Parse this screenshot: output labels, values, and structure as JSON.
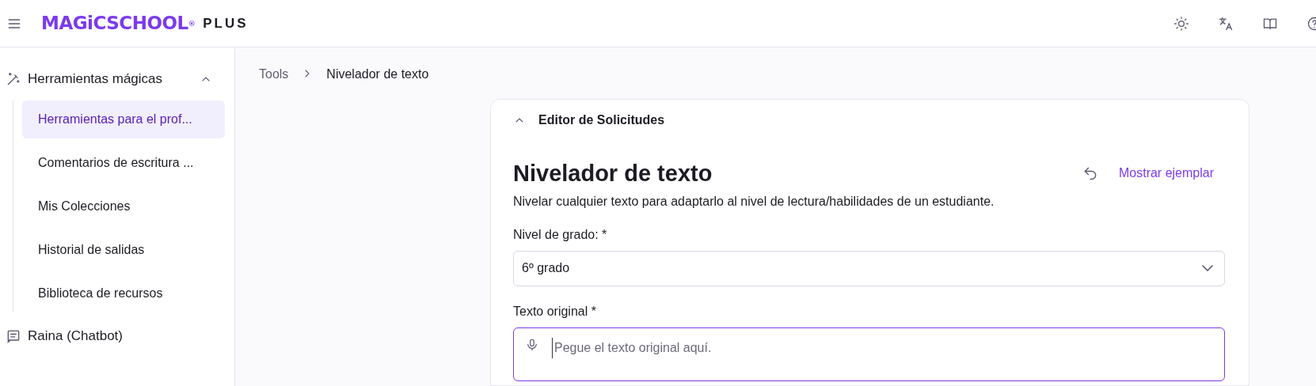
{
  "header": {
    "logo": "MAGiCSCHOOL",
    "logo_mark": "®",
    "plan": "PLUS"
  },
  "sidebar": {
    "groups": [
      {
        "label": "Herramientas mágicas",
        "expanded": true,
        "items": [
          {
            "label": "Herramientas para el prof...",
            "selected": true
          },
          {
            "label": "Comentarios de escritura ...",
            "selected": false
          },
          {
            "label": "Mis Colecciones",
            "selected": false
          },
          {
            "label": "Historial de salidas",
            "selected": false
          },
          {
            "label": "Biblioteca de recursos",
            "selected": false
          }
        ]
      },
      {
        "label": "Raina (Chatbot)"
      }
    ]
  },
  "breadcrumb": [
    "Tools",
    "Nivelador de texto"
  ],
  "panel": {
    "title": "Editor de Solicitudes",
    "expanded": true,
    "heading": "Nivelador de texto",
    "example_link": "Mostrar ejemplar",
    "description": "Nivelar cualquier texto para adaptarlo al nivel de lectura/habilidades de un estudiante.",
    "fields": [
      {
        "kind": "select",
        "label": "Nivel de grado: *",
        "value": "6º grado"
      },
      {
        "kind": "textarea",
        "label": "Texto original *",
        "placeholder": "Pegue el texto original aquí.",
        "focused": true
      }
    ]
  }
}
